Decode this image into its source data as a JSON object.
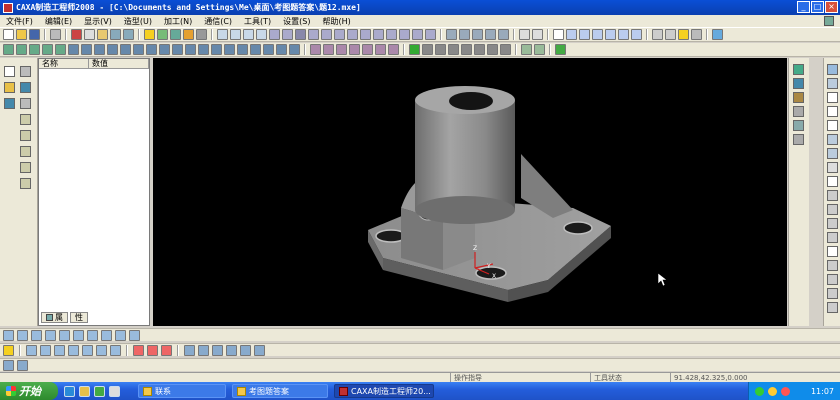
{
  "window": {
    "title": "CAXA制造工程师2008  - [C:\\Documents and Settings\\Me\\桌面\\考图题答案\\题12.mxe]",
    "controls": [
      "_",
      "□",
      "×"
    ]
  },
  "menu": {
    "items": [
      "文件(F)",
      "编辑(E)",
      "显示(V)",
      "造型(U)",
      "加工(N)",
      "通信(C)",
      "工具(T)",
      "设置(S)",
      "帮助(H)"
    ]
  },
  "tree_panel": {
    "columns": [
      "名称",
      "数值"
    ],
    "tabs": [
      "属",
      "性"
    ]
  },
  "status": {
    "hint": "操作指导",
    "tool_state": "工具状态",
    "coords": "91.428,42.325,0.000"
  },
  "taskbar": {
    "start_label": "开始",
    "tasks": [
      "联系",
      "考图题答案",
      "CAXA制造工程师20..."
    ],
    "clock": "11:07"
  },
  "colors": {
    "title_bar": "#0a4fd6",
    "viewport_bg": "#000000",
    "model_gray": "#8a8a8a",
    "taskbar": "#245edb"
  }
}
